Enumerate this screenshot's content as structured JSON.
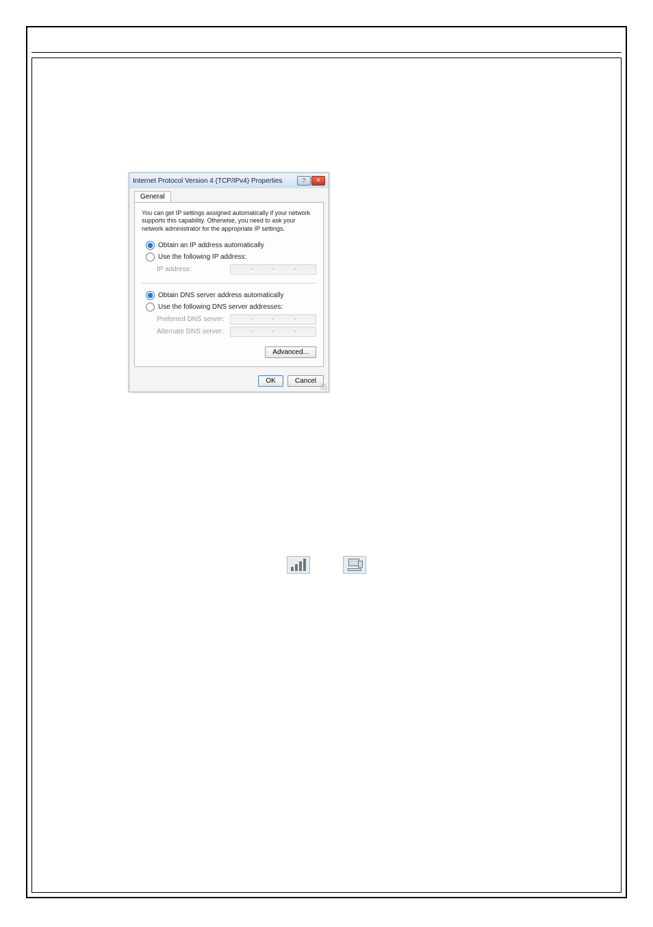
{
  "dialog": {
    "title": "Internet Protocol Version 4 (TCP/IPv4) Properties",
    "tab": "General",
    "description": "You can get IP settings assigned automatically if your network supports this capability. Otherwise, you need to ask your network administrator for the appropriate IP settings.",
    "ip_group": {
      "auto_label": "Obtain an IP address automatically",
      "manual_label": "Use the following IP address:",
      "selected": "auto",
      "fields": {
        "ip_address_label": "IP address:"
      }
    },
    "dns_group": {
      "auto_label": "Obtain DNS server address automatically",
      "manual_label": "Use the following DNS server addresses:",
      "selected": "auto",
      "fields": {
        "preferred_label": "Preferred DNS server:",
        "alternate_label": "Alternate DNS server:"
      }
    },
    "buttons": {
      "advanced": "Advanced...",
      "ok": "OK",
      "cancel": "Cancel"
    }
  },
  "tray_icons": {
    "wireless": "wireless-signal-icon",
    "network": "network-adapter-icon"
  }
}
